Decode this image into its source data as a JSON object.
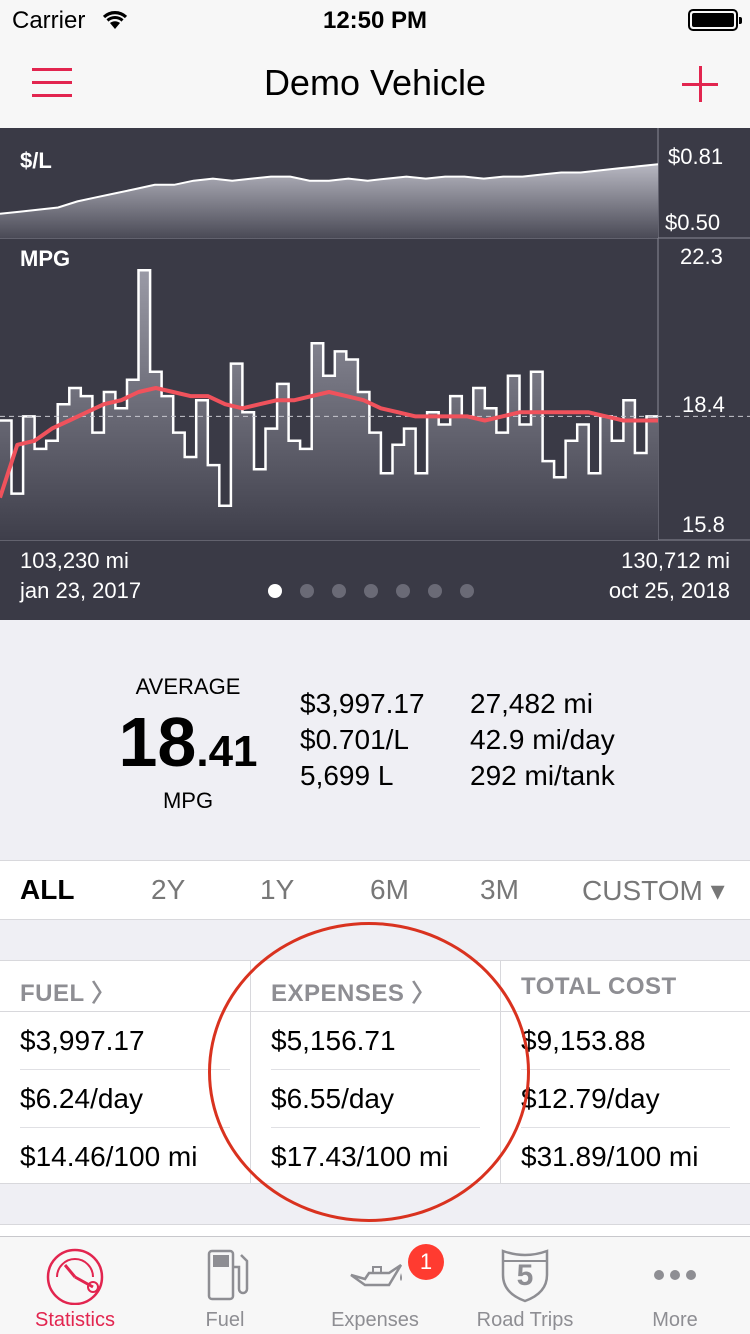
{
  "status_bar": {
    "carrier": "Carrier",
    "time": "12:50 PM"
  },
  "nav": {
    "title": "Demo Vehicle",
    "menu_icon": "hamburger-icon",
    "add_icon": "plus-icon"
  },
  "colors": {
    "accent": "#e2254f",
    "chart_bg": "#3a3a46",
    "trend_line": "#f0525c",
    "highlight_circle": "#d9321f"
  },
  "chart": {
    "price_label": "$/L",
    "price_max": "$0.81",
    "price_min": "$0.50",
    "mpg_label": "MPG",
    "mpg_max": "22.3",
    "mpg_avg": "18.4",
    "mpg_min": "15.8",
    "start_odometer": "103,230 mi",
    "start_date": "jan 23, 2017",
    "end_odometer": "130,712 mi",
    "end_date": "oct 25, 2018",
    "page_count": 7,
    "active_page": 0
  },
  "chart_data": [
    {
      "type": "area",
      "ylabel": "$/L",
      "ylim": [
        0.5,
        0.81
      ],
      "values": [
        0.54,
        0.55,
        0.56,
        0.57,
        0.6,
        0.62,
        0.64,
        0.66,
        0.68,
        0.68,
        0.7,
        0.71,
        0.7,
        0.71,
        0.72,
        0.72,
        0.7,
        0.7,
        0.71,
        0.7,
        0.71,
        0.72,
        0.71,
        0.72,
        0.72,
        0.71,
        0.72,
        0.72,
        0.73,
        0.74,
        0.74,
        0.75,
        0.76,
        0.77,
        0.78
      ]
    },
    {
      "type": "line",
      "ylabel": "MPG",
      "ylim": [
        15.8,
        22.3
      ],
      "avg_reference": 18.4,
      "series": [
        {
          "values": [
            18.3,
            16.5,
            18.4,
            17.6,
            17.8,
            18.7,
            19.1,
            18.9,
            18.0,
            19.0,
            18.6,
            19.3,
            22.0,
            19.5,
            18.9,
            18.0,
            17.4,
            18.8,
            17.2,
            16.2,
            19.7,
            18.5,
            17.1,
            18.1,
            19.2,
            17.8,
            17.6,
            20.2,
            19.4,
            20.0,
            19.8,
            19.0,
            18.0,
            17.0,
            17.7,
            18.1,
            17.0,
            18.5,
            18.2,
            18.9,
            18.4,
            19.1,
            18.6,
            18.0,
            19.4,
            18.2,
            19.5,
            17.3,
            16.9,
            17.8,
            18.2,
            17.0,
            18.4,
            17.8,
            18.8,
            17.5,
            18.4
          ]
        },
        {
          "values": [
            16.4,
            17.7,
            17.8,
            18.1,
            18.3,
            18.5,
            18.7,
            18.8,
            19.0,
            19.1,
            19.0,
            18.9,
            18.9,
            18.7,
            18.6,
            18.7,
            18.8,
            18.8,
            18.9,
            19.0,
            18.9,
            18.8,
            18.6,
            18.5,
            18.4,
            18.4,
            18.4,
            18.4,
            18.3,
            18.4,
            18.5,
            18.5,
            18.5,
            18.5,
            18.5,
            18.4,
            18.3,
            18.3,
            18.3
          ]
        }
      ]
    }
  ],
  "summary": {
    "average_label": "AVERAGE",
    "average_int": "18",
    "average_dec": ".41",
    "average_unit": "MPG",
    "stats_left": [
      "$3,997.17",
      "$0.701/L",
      "5,699 L"
    ],
    "stats_right": [
      "27,482 mi",
      "42.9 mi/day",
      "292 mi/tank"
    ]
  },
  "ranges": [
    "ALL",
    "2Y",
    "1Y",
    "6M",
    "3M",
    "CUSTOM ▾"
  ],
  "costs": [
    {
      "header": "FUEL 〉",
      "values": [
        "$3,997.17",
        "$6.24/day",
        "$14.46/100 mi"
      ]
    },
    {
      "header": "EXPENSES 〉",
      "values": [
        "$5,156.71",
        "$6.55/day",
        "$17.43/100 mi"
      ]
    },
    {
      "header": "TOTAL COST",
      "values": [
        "$9,153.88",
        "$12.79/day",
        "$31.89/100 mi"
      ]
    }
  ],
  "tabs": [
    {
      "label": "Statistics",
      "icon": "speedometer-icon"
    },
    {
      "label": "Fuel",
      "icon": "fuel-pump-icon"
    },
    {
      "label": "Expenses",
      "icon": "oil-can-icon",
      "badge": "1"
    },
    {
      "label": "Road Trips",
      "icon": "highway-shield-icon",
      "shield_number": "5"
    },
    {
      "label": "More",
      "icon": "more-dots-icon"
    }
  ]
}
